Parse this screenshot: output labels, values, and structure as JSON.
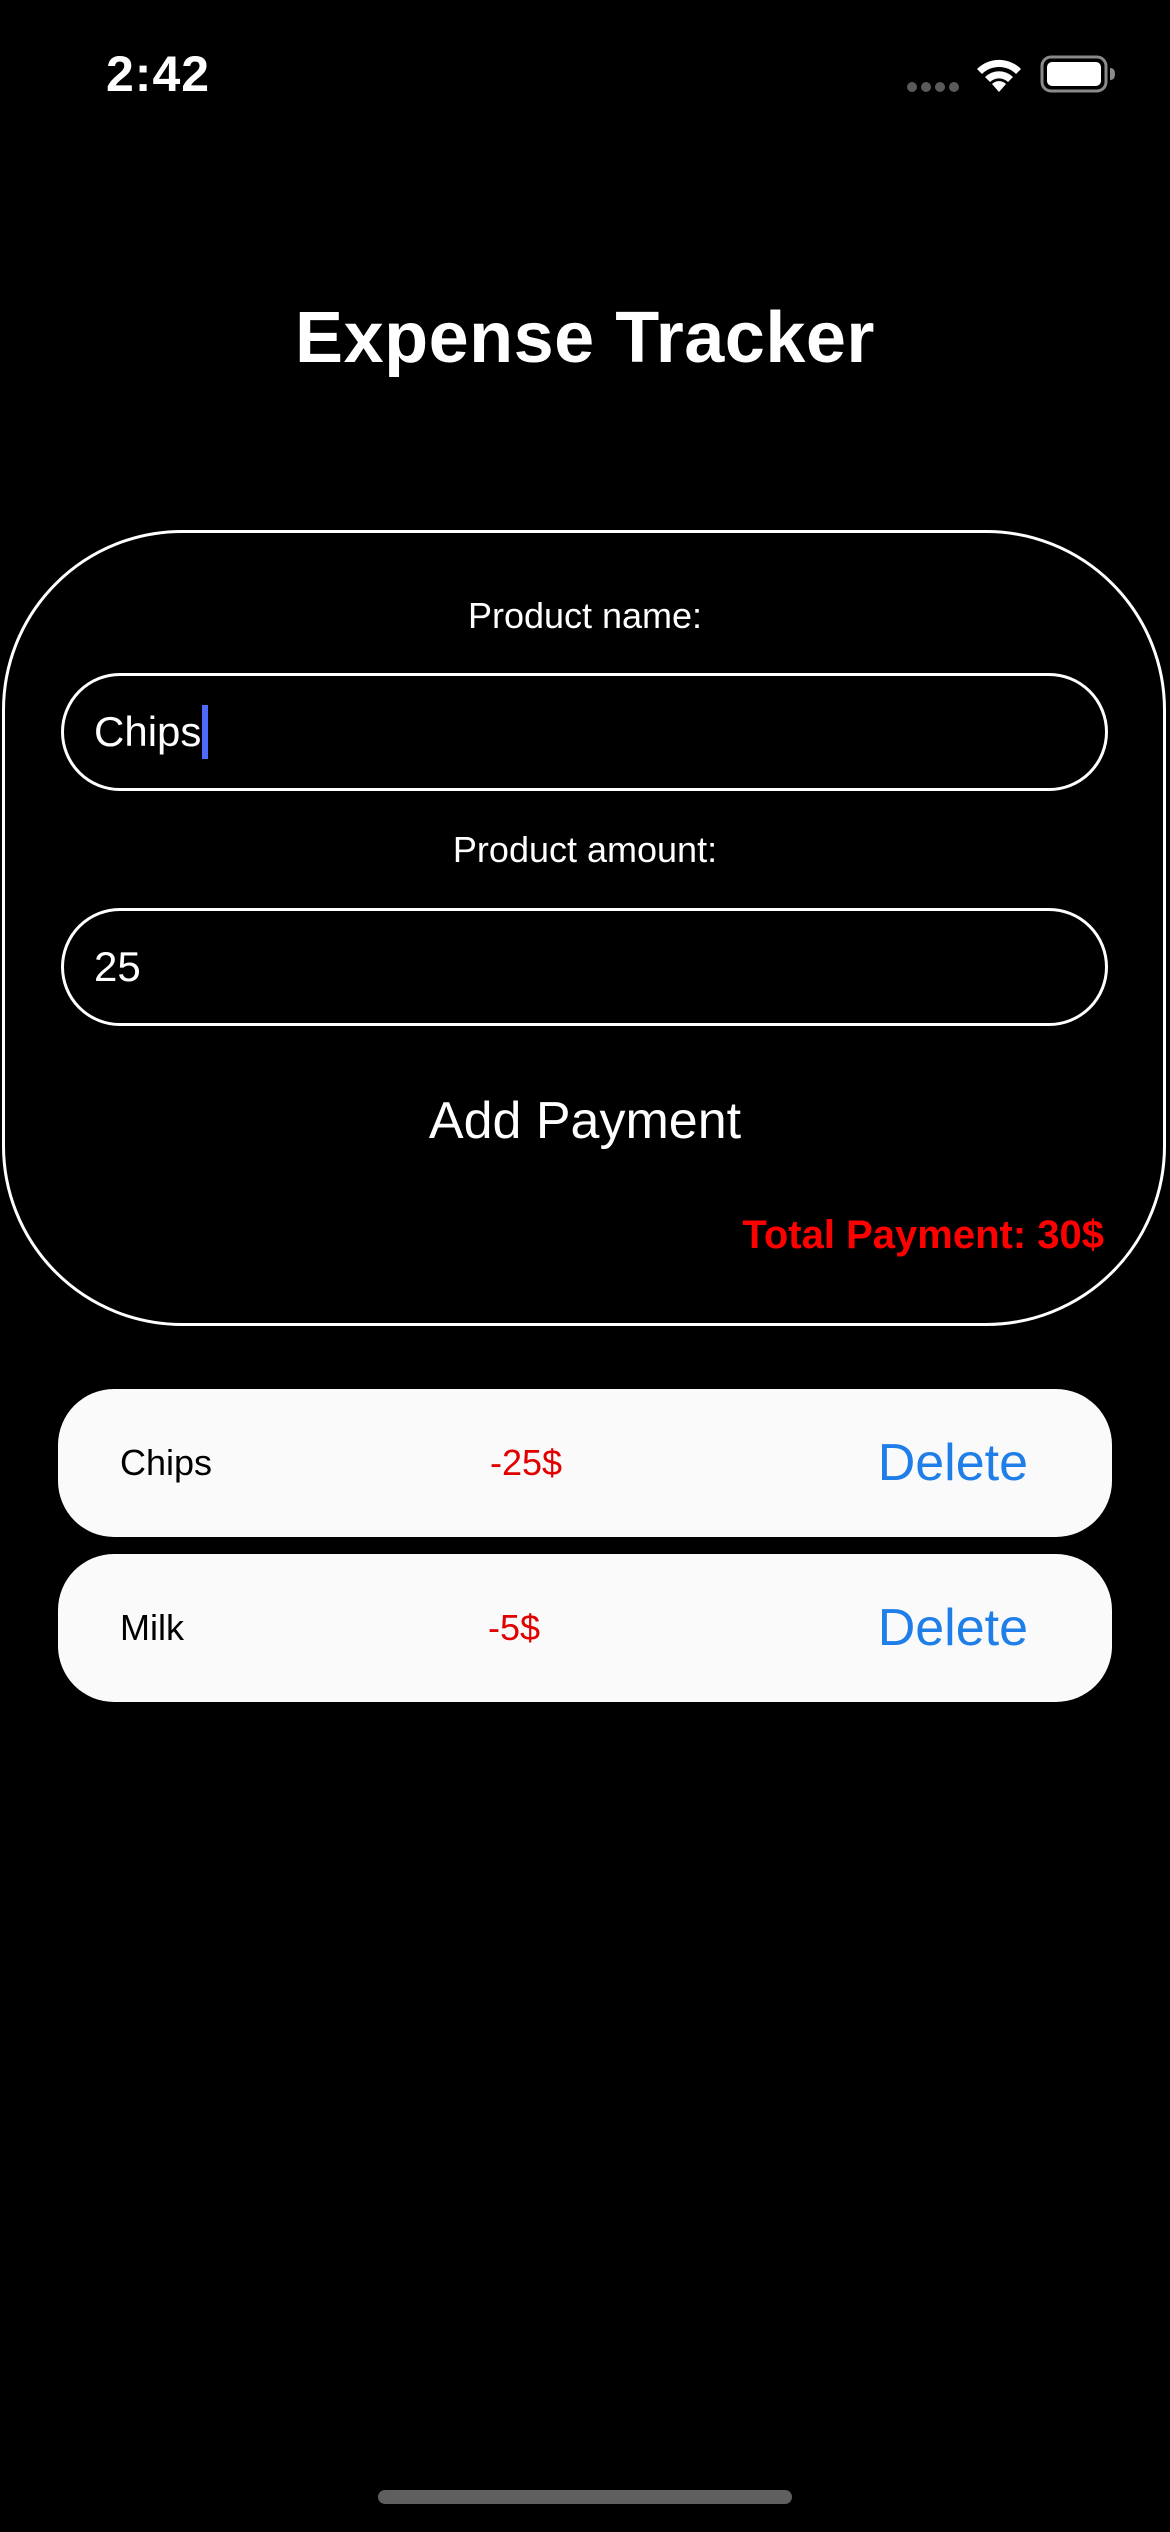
{
  "status_bar": {
    "time": "2:42"
  },
  "header": {
    "title": "Expense Tracker"
  },
  "form": {
    "name_label": "Product name:",
    "name_value": "Chips",
    "amount_label": "Product amount:",
    "amount_value": "25",
    "add_button_label": "Add Payment",
    "total_text": "Total Payment: 30$"
  },
  "expenses": [
    {
      "name": "Chips",
      "amount": "-25$",
      "delete_label": "Delete"
    },
    {
      "name": "Milk",
      "amount": "-5$",
      "delete_label": "Delete"
    }
  ],
  "colors": {
    "background": "#000000",
    "total": "#ff0000",
    "amount": "#e00000",
    "delete": "#1f7ee8",
    "row_background": "#fafafa",
    "caret": "#4b6bff"
  }
}
